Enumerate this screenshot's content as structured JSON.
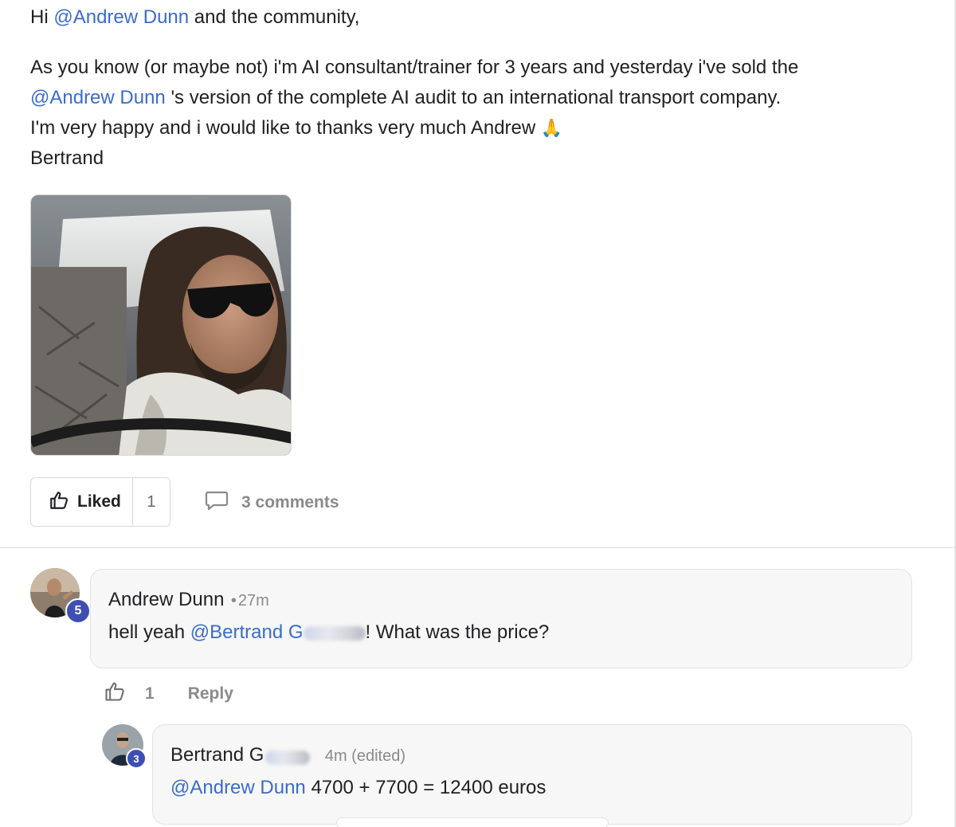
{
  "post": {
    "greeting_prefix": "Hi ",
    "greeting_mention": "@Andrew Dunn",
    "greeting_suffix": " and the community,",
    "line1": "As you know (or maybe not) i'm AI consultant/trainer for 3 years and yesterday i've sold the",
    "mention2": "@Andrew Dunn",
    "line2_suffix": " 's version of the complete AI audit to an international transport company.",
    "line3": "I'm very happy and i would like to thanks very much Andrew",
    "line3_emoji": "🙏",
    "signature": "Bertrand"
  },
  "actions": {
    "like_label": "Liked",
    "like_count": "1",
    "comments_label": "3 comments"
  },
  "comments": [
    {
      "author": "Andrew Dunn",
      "separator": "•",
      "time": "27m",
      "level_badge": "5",
      "text_prefix": "hell yeah ",
      "mention": "@Bertrand G",
      "text_suffix": "! What was the price?",
      "like_count": "1",
      "reply_label": "Reply"
    },
    {
      "author": "Bertrand G",
      "time": "4m (edited)",
      "level_badge": "3",
      "mention": "@Andrew Dunn",
      "text_suffix": " 4700 + 7700 = 12400 euros"
    }
  ],
  "icons": {
    "like": "thumbs-up-icon",
    "comment": "speech-bubble-icon"
  },
  "colors": {
    "mention": "#3b6cc9",
    "badge": "#3e4fb4",
    "muted": "#8a8a8a"
  }
}
